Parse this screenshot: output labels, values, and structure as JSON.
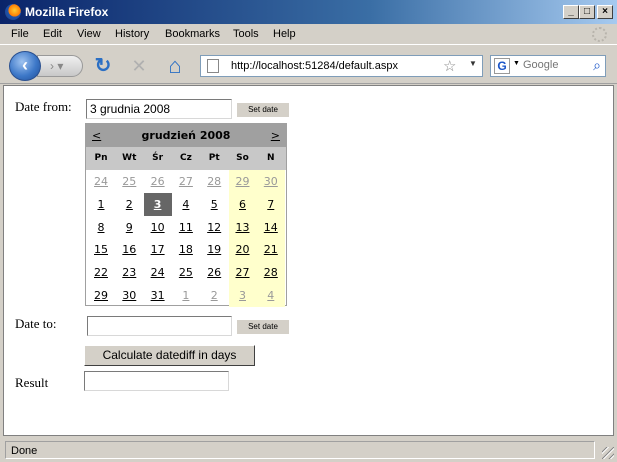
{
  "window": {
    "title": "Mozilla Firefox",
    "min": "_",
    "max": "□",
    "close": "×"
  },
  "menu": {
    "items": [
      "File",
      "Edit",
      "View",
      "History",
      "Bookmarks",
      "Tools",
      "Help"
    ]
  },
  "nav": {
    "back": "‹",
    "forward": "›",
    "reload": "↻",
    "stop": "✕",
    "home": "⌂",
    "url": "http://localhost:51284/default.aspx",
    "search_placeholder": "Google"
  },
  "form": {
    "date_from_label": "Date from:",
    "date_from_value": "3 grudnia 2008",
    "set_date_label": "Set date",
    "date_to_label": "Date to:",
    "date_to_value": "",
    "calculate_label": "Calculate datediff in days",
    "result_label": "Result",
    "result_value": ""
  },
  "calendar": {
    "prev": "<",
    "next": ">",
    "month_title": "grudzień 2008",
    "weekdays": [
      "Pn",
      "Wt",
      "Śr",
      "Cz",
      "Pt",
      "So",
      "N"
    ],
    "selected": "3",
    "weeks": [
      [
        {
          "d": "24",
          "other": true
        },
        {
          "d": "25",
          "other": true
        },
        {
          "d": "26",
          "other": true
        },
        {
          "d": "27",
          "other": true
        },
        {
          "d": "28",
          "other": true
        },
        {
          "d": "29",
          "other": true
        },
        {
          "d": "30",
          "other": true
        }
      ],
      [
        {
          "d": "1"
        },
        {
          "d": "2"
        },
        {
          "d": "3"
        },
        {
          "d": "4"
        },
        {
          "d": "5"
        },
        {
          "d": "6"
        },
        {
          "d": "7"
        }
      ],
      [
        {
          "d": "8"
        },
        {
          "d": "9"
        },
        {
          "d": "10"
        },
        {
          "d": "11"
        },
        {
          "d": "12"
        },
        {
          "d": "13"
        },
        {
          "d": "14"
        }
      ],
      [
        {
          "d": "15"
        },
        {
          "d": "16"
        },
        {
          "d": "17"
        },
        {
          "d": "18"
        },
        {
          "d": "19"
        },
        {
          "d": "20"
        },
        {
          "d": "21"
        }
      ],
      [
        {
          "d": "22"
        },
        {
          "d": "23"
        },
        {
          "d": "24"
        },
        {
          "d": "25"
        },
        {
          "d": "26"
        },
        {
          "d": "27"
        },
        {
          "d": "28"
        }
      ],
      [
        {
          "d": "29"
        },
        {
          "d": "30"
        },
        {
          "d": "31"
        },
        {
          "d": "1",
          "other": true
        },
        {
          "d": "2",
          "other": true
        },
        {
          "d": "3",
          "other": true
        },
        {
          "d": "4",
          "other": true
        }
      ]
    ]
  },
  "status": {
    "text": "Done"
  }
}
